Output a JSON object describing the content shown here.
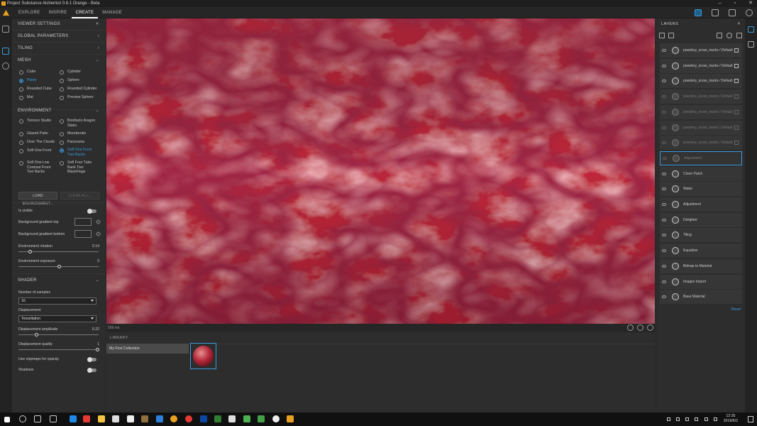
{
  "window": {
    "title": "Project Substance Alchemist 0.6.1 Orange - Beta"
  },
  "nav": {
    "tabs": [
      "EXPLORE",
      "INSPIRE",
      "CREATE",
      "MANAGE"
    ],
    "active": "CREATE"
  },
  "viewer_settings": {
    "title": "VIEWER SETTINGS",
    "sections": {
      "global": "GLOBAL PARAMETERS",
      "tiling": "TILING",
      "mesh": "MESH",
      "environment": "ENVIRONMENT",
      "shader": "SHADER"
    },
    "mesh_options": [
      "Cube",
      "Cylinder",
      "Plane",
      "Sphere",
      "Rounded Cube",
      "Rounded Cylinder",
      "Mat",
      "Preview Sphere"
    ],
    "mesh_selected": "Plane",
    "env_options": [
      "Tomoco Studio",
      "Bonifacio Aragon Stairs",
      "Glazed Patio",
      "Mondarrain",
      "Over The Clouds",
      "Panorama",
      "Soft One Front",
      "Soft One Front Two Backs",
      "Soft One Low Contrast Front Two Backs",
      "Soft Four Tube Bank Two BlackFlags"
    ],
    "env_selected": "Soft One Front Two Backs",
    "load_env": "LOAD ENVIRONMENT...",
    "clear_all": "CLEAR ALL...",
    "is_visible": "Is visible",
    "bg_top": "Background gradient top",
    "bg_bottom": "Background gradient bottom",
    "env_rotation": {
      "label": "Environment rotation",
      "value": "0.14"
    },
    "env_exposure": {
      "label": "Environment exposure",
      "value": "0"
    },
    "samples": {
      "label": "Number of samples",
      "value": "16"
    },
    "displacement": {
      "label": "Displacement",
      "value": "Tessellation"
    },
    "disp_amp": {
      "label": "Displacement amplitude",
      "value": "0.22"
    },
    "disp_quality": {
      "label": "Displacement quality",
      "value": "1"
    },
    "mipmaps": "Use mipmaps for opacity",
    "shadows": "Shadows"
  },
  "viewport": {
    "timing": "559 ms"
  },
  "library": {
    "title": "LIBRARY",
    "collection": "My First Collection"
  },
  "layers": {
    "title": "LAYERS",
    "items": [
      {
        "name": "powdery_snow_marks / Default",
        "dim": false,
        "mask": true
      },
      {
        "name": "powdery_snow_marks / Default",
        "dim": false,
        "mask": true
      },
      {
        "name": "powdery_snow_marks / Default",
        "dim": false,
        "mask": true
      },
      {
        "name": "powdery_snow_marks / Default",
        "dim": true,
        "mask": true
      },
      {
        "name": "powdery_snow_marks / Default",
        "dim": true,
        "mask": true
      },
      {
        "name": "powdery_snow_marks / Default",
        "dim": true,
        "mask": true
      },
      {
        "name": "powdery_snow_marks / Default",
        "dim": true,
        "mask": true
      },
      {
        "name": "Adjustment",
        "dim": true,
        "mask": false,
        "selected": true
      },
      {
        "name": "Clone Patch",
        "dim": false,
        "mask": false
      },
      {
        "name": "Water",
        "dim": false,
        "mask": false
      },
      {
        "name": "Adjustment",
        "dim": false,
        "mask": false
      },
      {
        "name": "Delighter",
        "dim": false,
        "mask": false
      },
      {
        "name": "Tiling",
        "dim": false,
        "mask": false
      },
      {
        "name": "Equalizer",
        "dim": false,
        "mask": false
      },
      {
        "name": "Bitmap to Material",
        "dim": false,
        "mask": false
      },
      {
        "name": "Images Import",
        "dim": false,
        "mask": false
      },
      {
        "name": "Base Material",
        "dim": false,
        "mask": false
      }
    ],
    "reset": "Reset"
  },
  "taskbar": {
    "time": "12:35",
    "date": "2019/6/2"
  }
}
